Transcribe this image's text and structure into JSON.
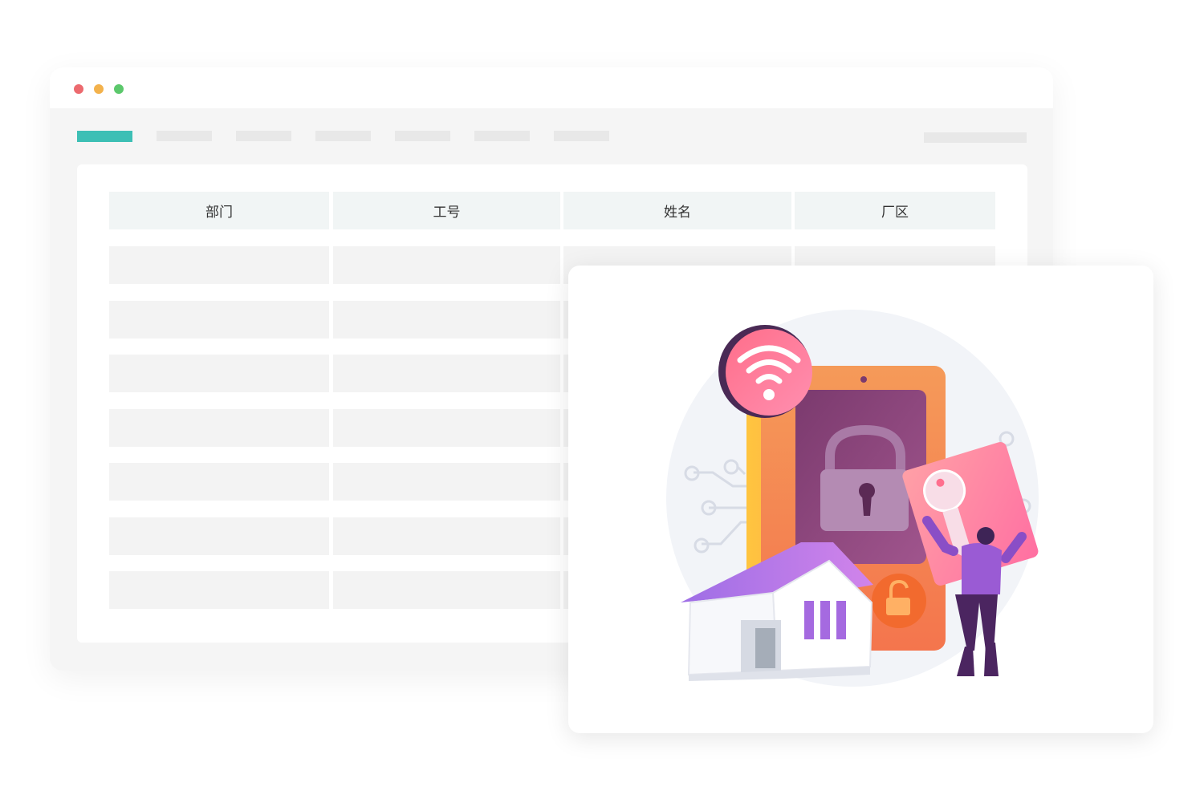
{
  "window": {
    "traffic_lights": [
      {
        "name": "close",
        "color": "#ec6a6f"
      },
      {
        "name": "minimize",
        "color": "#f3b24c"
      },
      {
        "name": "maximize",
        "color": "#5cc86c"
      }
    ],
    "accent_color": "#3dbfb5"
  },
  "table": {
    "columns": [
      "部门",
      "工号",
      "姓名",
      "厂区"
    ],
    "row_count": 7
  },
  "illustration": {
    "icons": [
      "wifi-icon",
      "padlock-icon",
      "key-icon",
      "unlock-icon",
      "house-icon",
      "person-icon"
    ],
    "colors": {
      "tablet_frame": "#f7a14d",
      "screen": "#7b3f6e",
      "wifi_badge": "#ff6f8e",
      "key_card": "#ff8fa6",
      "roof": "#b77ee6",
      "person": "#9a5bd4"
    }
  }
}
